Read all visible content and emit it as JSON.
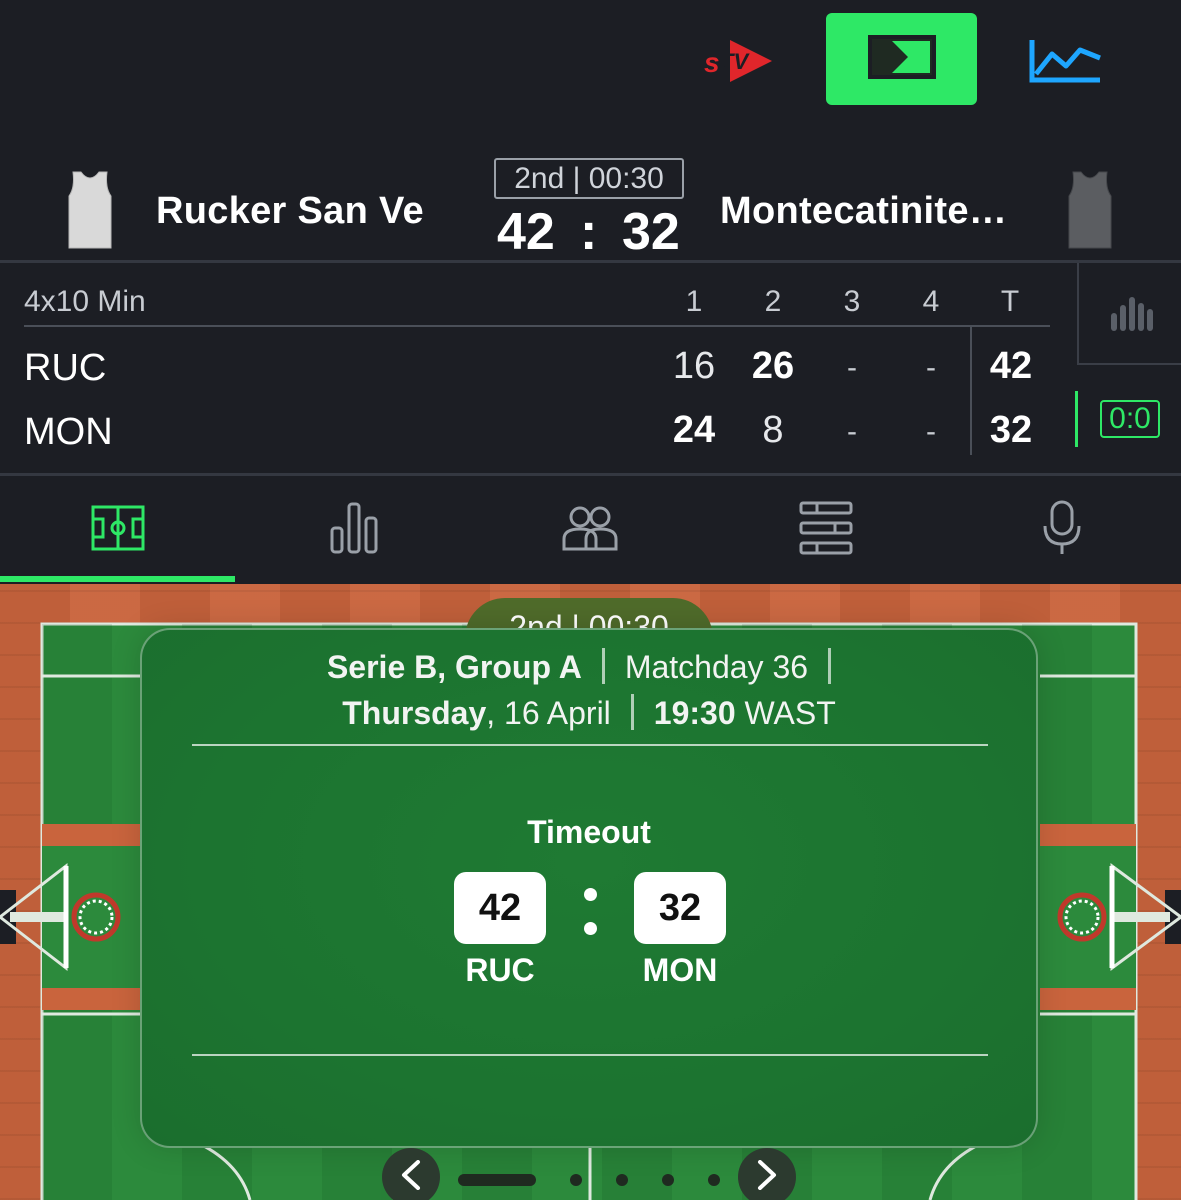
{
  "header": {
    "stv_logo_icon": "stv-logo-icon",
    "tv_button_icon": "live-tracker-icon",
    "chart_button_icon": "line-chart-icon",
    "accent_color": "#2ee866"
  },
  "match": {
    "period_clock": "2nd | 00:30",
    "home": {
      "name": "Rucker San Ve",
      "abbr": "RUC",
      "score": "42"
    },
    "away": {
      "name": "Montecatiniterme Basketball",
      "abbr": "MON",
      "score": "32"
    },
    "score_separator": ":"
  },
  "periods": {
    "format": "4x10 Min",
    "headers": [
      "1",
      "2",
      "3",
      "4",
      "T"
    ],
    "home_row": [
      "16",
      "26",
      "-",
      "-",
      "42"
    ],
    "away_row": [
      "24",
      "8",
      "-",
      "-",
      "32"
    ],
    "side_badge": "0:0"
  },
  "tabs": [
    {
      "icon": "court-icon",
      "active": true
    },
    {
      "icon": "bar-chart-icon",
      "active": false
    },
    {
      "icon": "players-icon",
      "active": false
    },
    {
      "icon": "standings-icon",
      "active": false
    },
    {
      "icon": "microphone-icon",
      "active": false
    }
  ],
  "card": {
    "period_pill": "2nd | 00:30",
    "competition": "Serie B, Group A",
    "matchday": "Matchday 36",
    "day": "Thursday",
    "date": ", 16 April",
    "time": "19:30",
    "timezone": " WAST",
    "status": "Timeout",
    "home_score": "42",
    "away_score": "32",
    "home_abbr": "RUC",
    "away_abbr": "MON"
  }
}
